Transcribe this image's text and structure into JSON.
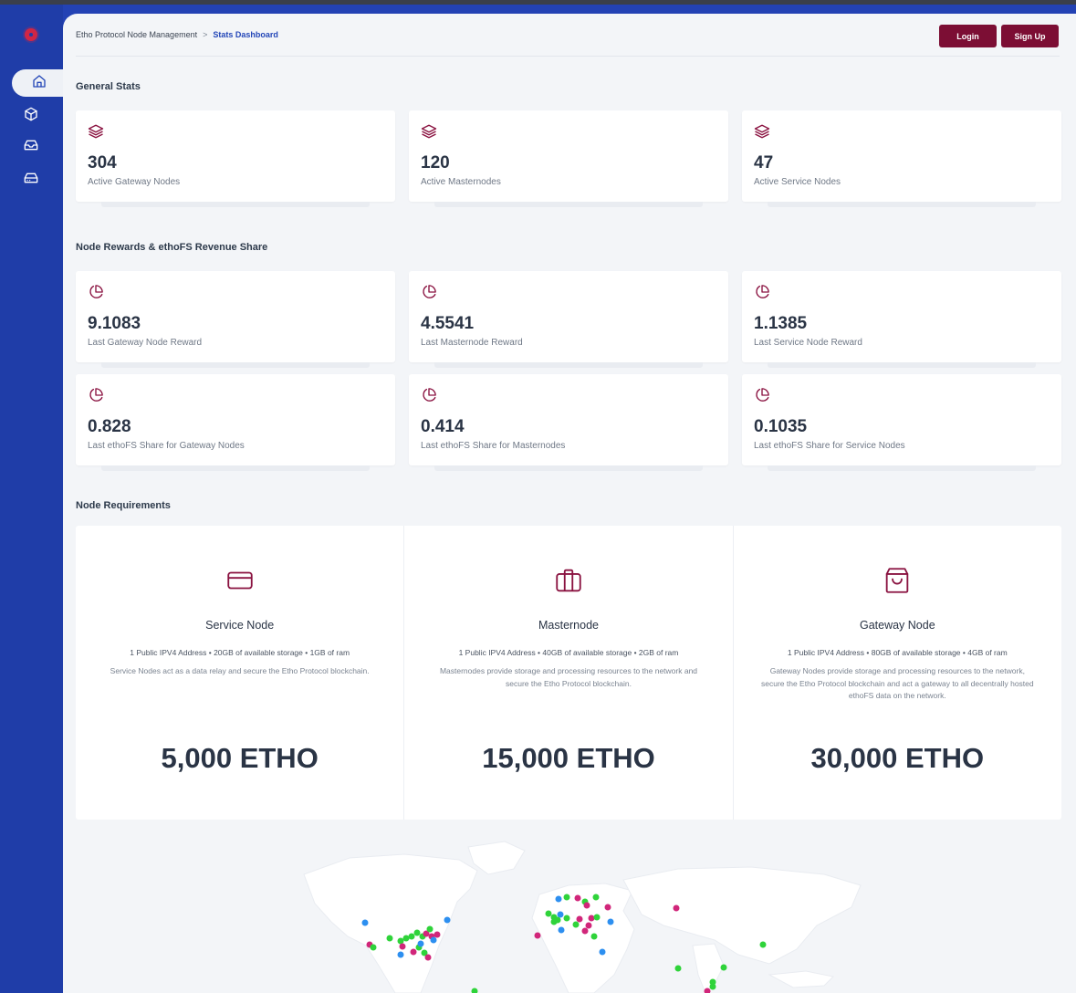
{
  "breadcrumb": {
    "parent": "Etho Protocol Node Management",
    "separator": ">",
    "current": "Stats Dashboard"
  },
  "auth": {
    "login_label": "Login",
    "signup_label": "Sign Up"
  },
  "sidebar": {
    "items": [
      {
        "icon": "home-icon",
        "active": true
      },
      {
        "icon": "cube-icon",
        "active": false
      },
      {
        "icon": "inbox-icon",
        "active": false
      },
      {
        "icon": "hard-drive-icon",
        "active": false
      }
    ]
  },
  "general_stats": {
    "title": "General Stats",
    "cards": [
      {
        "value": "304",
        "label": "Active Gateway Nodes",
        "icon": "layers-icon"
      },
      {
        "value": "120",
        "label": "Active Masternodes",
        "icon": "layers-icon"
      },
      {
        "value": "47",
        "label": "Active Service Nodes",
        "icon": "layers-icon"
      }
    ]
  },
  "rewards": {
    "title": "Node Rewards & ethoFS Revenue Share",
    "cards": [
      {
        "value": "9.1083",
        "label": "Last Gateway Node Reward",
        "icon": "pie-chart-icon"
      },
      {
        "value": "4.5541",
        "label": "Last Masternode Reward",
        "icon": "pie-chart-icon"
      },
      {
        "value": "1.1385",
        "label": "Last Service Node Reward",
        "icon": "pie-chart-icon"
      },
      {
        "value": "0.828",
        "label": "Last ethoFS Share for Gateway Nodes",
        "icon": "pie-chart-icon"
      },
      {
        "value": "0.414",
        "label": "Last ethoFS Share for Masternodes",
        "icon": "pie-chart-icon"
      },
      {
        "value": "0.1035",
        "label": "Last ethoFS Share for Service Nodes",
        "icon": "pie-chart-icon"
      }
    ]
  },
  "requirements": {
    "title": "Node Requirements",
    "nodes": [
      {
        "icon": "credit-card-icon",
        "name": "Service Node",
        "spec": "1 Public IPV4 Address  •  20GB of available storage  •  1GB of ram",
        "description": "Service Nodes act as a data relay and secure the Etho Protocol blockchain.",
        "price": "5,000 ETHO"
      },
      {
        "icon": "briefcase-icon",
        "name": "Masternode",
        "spec": "1 Public IPV4 Address  •  40GB of available storage  •  2GB of ram",
        "description": "Masternodes provide storage and processing resources to the network and secure the Etho Protocol blockchain.",
        "price": "15,000 ETHO"
      },
      {
        "icon": "shopping-bag-icon",
        "name": "Gateway Node",
        "spec": "1 Public IPV4 Address  •  80GB of available storage  •  4GB of ram",
        "description": "Gateway Nodes provide storage and processing resources to the network, secure the Etho Protocol blockchain and act a gateway to all decentrally hosted ethoFS data on the network.",
        "price": "30,000 ETHO"
      }
    ]
  },
  "colors": {
    "accent": "#7c0e34",
    "sidebar": "#1f3da8",
    "service_dot": "#2fd33a",
    "master_dot": "#d1267a",
    "gateway_dot": "#2d8ff0"
  }
}
